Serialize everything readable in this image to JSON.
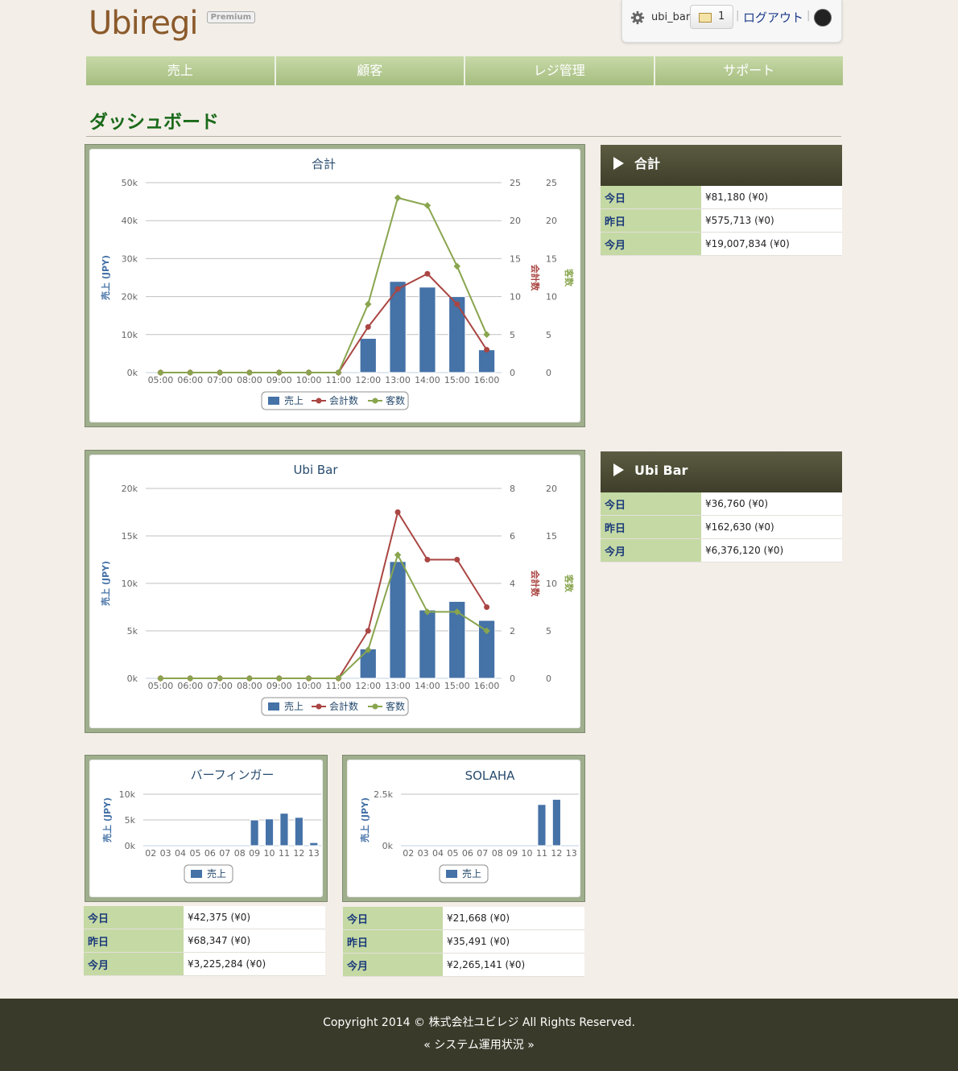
{
  "header": {
    "logo": "Ubiregi",
    "badge": "Premium",
    "username": "ubi_bar",
    "mail_count": "1",
    "logout": "ログアウト"
  },
  "nav": [
    "売上",
    "顧客",
    "レジ管理",
    "サポート"
  ],
  "page_title": "ダッシュボード",
  "legend": {
    "sales": "売上",
    "checks": "会計数",
    "customers": "客数"
  },
  "axis_labels": {
    "sales": "売上 (JPY)",
    "checks": "会計数",
    "customers": "客数"
  },
  "stat_keys": [
    "今日",
    "昨日",
    "今月"
  ],
  "summaries": {
    "total": {
      "title": "合計",
      "values": [
        "¥81,180 (¥0)",
        "¥575,713 (¥0)",
        "¥19,007,834 (¥0)"
      ]
    },
    "ubibar": {
      "title": "Ubi Bar",
      "values": [
        "¥36,760 (¥0)",
        "¥162,630 (¥0)",
        "¥6,376,120 (¥0)"
      ]
    },
    "barfinger": {
      "values": [
        "¥42,375 (¥0)",
        "¥68,347 (¥0)",
        "¥3,225,284 (¥0)"
      ]
    },
    "solaha": {
      "values": [
        "¥21,668 (¥0)",
        "¥35,491 (¥0)",
        "¥2,265,141 (¥0)"
      ]
    }
  },
  "chart_data": [
    {
      "type": "bar",
      "title": "合計",
      "categories": [
        "05:00",
        "06:00",
        "07:00",
        "08:00",
        "09:00",
        "10:00",
        "11:00",
        "12:00",
        "13:00",
        "14:00",
        "15:00",
        "16:00"
      ],
      "ylabel": "売上 (JPY)",
      "ylim": [
        0,
        50000
      ],
      "y_ticks": [
        "0k",
        "10k",
        "20k",
        "30k",
        "40k",
        "50k"
      ],
      "y2_label": "会計数",
      "y2lim": [
        0,
        25
      ],
      "y2_ticks": [
        "0",
        "5",
        "10",
        "15",
        "20",
        "25"
      ],
      "y3_label": "客数",
      "y3lim": [
        0,
        25
      ],
      "y3_ticks": [
        "0",
        "5",
        "10",
        "15",
        "20",
        "25"
      ],
      "series": [
        {
          "name": "売上",
          "type": "bar",
          "axis": "y",
          "color": "#4572a7",
          "values": [
            0,
            0,
            0,
            0,
            0,
            0,
            0,
            9000,
            24000,
            22500,
            20000,
            6000
          ]
        },
        {
          "name": "会計数",
          "type": "line",
          "axis": "y2",
          "color": "#aa4643",
          "values": [
            0,
            0,
            0,
            0,
            0,
            0,
            0,
            6,
            11,
            13,
            9,
            3
          ]
        },
        {
          "name": "客数",
          "type": "line",
          "axis": "y3",
          "color": "#89a54e",
          "values": [
            0,
            0,
            0,
            0,
            0,
            0,
            0,
            9,
            23,
            22,
            14,
            5
          ]
        }
      ],
      "legend": "bottom"
    },
    {
      "type": "bar",
      "title": "Ubi Bar",
      "categories": [
        "05:00",
        "06:00",
        "07:00",
        "08:00",
        "09:00",
        "10:00",
        "11:00",
        "12:00",
        "13:00",
        "14:00",
        "15:00",
        "16:00"
      ],
      "ylabel": "売上 (JPY)",
      "ylim": [
        0,
        20000
      ],
      "y_ticks": [
        "0k",
        "5k",
        "10k",
        "15k",
        "20k"
      ],
      "y2_label": "会計数",
      "y2lim": [
        0,
        8
      ],
      "y2_ticks": [
        "0",
        "2",
        "4",
        "6",
        "8"
      ],
      "y3_label": "客数",
      "y3lim": [
        0,
        20
      ],
      "y3_ticks": [
        "0",
        "5",
        "10",
        "15",
        "20"
      ],
      "series": [
        {
          "name": "売上",
          "type": "bar",
          "axis": "y",
          "color": "#4572a7",
          "values": [
            0,
            0,
            0,
            0,
            0,
            0,
            0,
            3100,
            12300,
            7200,
            8100,
            6100
          ]
        },
        {
          "name": "会計数",
          "type": "line",
          "axis": "y2",
          "color": "#aa4643",
          "values": [
            0,
            0,
            0,
            0,
            0,
            0,
            0,
            2,
            7,
            5,
            5,
            3
          ]
        },
        {
          "name": "客数",
          "type": "line",
          "axis": "y3",
          "color": "#89a54e",
          "values": [
            0,
            0,
            0,
            0,
            0,
            0,
            0,
            3,
            13,
            7,
            7,
            5
          ]
        }
      ],
      "legend": "bottom"
    },
    {
      "type": "bar",
      "title": "バーフィンガー",
      "categories": [
        "02",
        "03",
        "04",
        "05",
        "06",
        "07",
        "08",
        "09",
        "10",
        "11",
        "12",
        "13"
      ],
      "ylabel": "売上 (JPY)",
      "ylim": [
        0,
        10000
      ],
      "y_ticks": [
        "0k",
        "5k",
        "10k"
      ],
      "series": [
        {
          "name": "売上",
          "type": "bar",
          "axis": "y",
          "color": "#4572a7",
          "values": [
            0,
            0,
            0,
            0,
            0,
            0,
            0,
            5000,
            5200,
            6300,
            5500,
            600
          ]
        }
      ],
      "legend": "bottom"
    },
    {
      "type": "bar",
      "title": "SOLAHA",
      "categories": [
        "02",
        "03",
        "04",
        "05",
        "06",
        "07",
        "08",
        "09",
        "10",
        "11",
        "12",
        "13"
      ],
      "ylabel": "売上 (JPY)",
      "ylim": [
        0,
        2500
      ],
      "y_ticks": [
        "0k",
        "2.5k"
      ],
      "series": [
        {
          "name": "売上",
          "type": "bar",
          "axis": "y",
          "color": "#4572a7",
          "values": [
            0,
            0,
            0,
            0,
            0,
            0,
            0,
            0,
            0,
            2000,
            2250,
            0
          ]
        }
      ],
      "legend": "bottom"
    }
  ],
  "footer": {
    "copyright": "Copyright 2014 © 株式会社ユビレジ All Rights Reserved.",
    "status_link": "« システム運用状況 »"
  }
}
